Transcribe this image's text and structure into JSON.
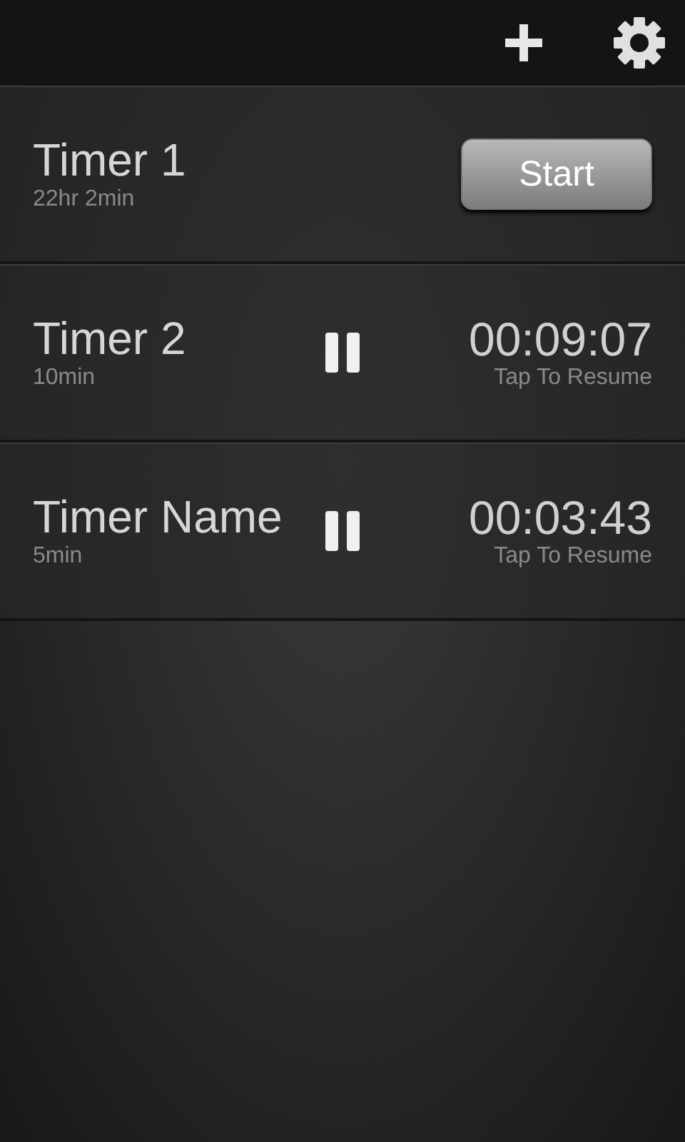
{
  "toolbar": {
    "actions": [
      {
        "kind": "add"
      },
      {
        "kind": "settings"
      }
    ]
  },
  "timers": [
    {
      "kind": "idle",
      "name": "Timer 1",
      "duration": "22hr 2min",
      "button": "Start"
    },
    {
      "kind": "paused",
      "name": "Timer 2",
      "duration": "10min",
      "time": "00:09:07",
      "hint": "Tap To Resume"
    },
    {
      "kind": "paused",
      "name": "Timer Name",
      "duration": "5min",
      "time": "00:03:43",
      "hint": "Tap To Resume"
    }
  ]
}
